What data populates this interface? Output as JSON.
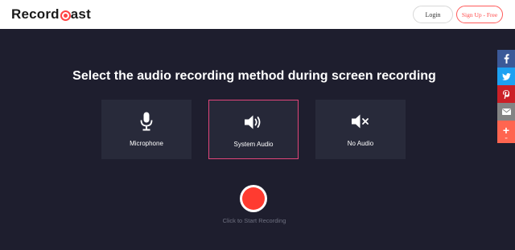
{
  "header": {
    "logo_part1": "Record",
    "logo_part2": "ast",
    "login_label": "Login",
    "signup_label": "Sign Up - Free"
  },
  "main": {
    "headline": "Select the audio recording method during screen recording",
    "options": [
      {
        "label": "Microphone",
        "icon": "microphone-icon",
        "selected": false
      },
      {
        "label": "System Audio",
        "icon": "speaker-icon",
        "selected": true
      },
      {
        "label": "No Audio",
        "icon": "speaker-muted-icon",
        "selected": false
      }
    ],
    "record_caption": "Click to Start Recording"
  },
  "share_bar": {
    "items": [
      {
        "name": "facebook",
        "icon": "facebook-icon",
        "color": "#3b5998"
      },
      {
        "name": "twitter",
        "icon": "twitter-icon",
        "color": "#1da1f2"
      },
      {
        "name": "pinterest",
        "icon": "pinterest-icon",
        "color": "#cb2027"
      },
      {
        "name": "email",
        "icon": "mail-icon",
        "color": "#848484"
      },
      {
        "name": "more",
        "icon": "plus-icon",
        "color": "#ff6550",
        "count": "∞"
      }
    ]
  },
  "colors": {
    "background": "#1e1e2e",
    "card": "#282a3a",
    "accent": "#ff3b30",
    "selected_border": "#e0457a"
  }
}
